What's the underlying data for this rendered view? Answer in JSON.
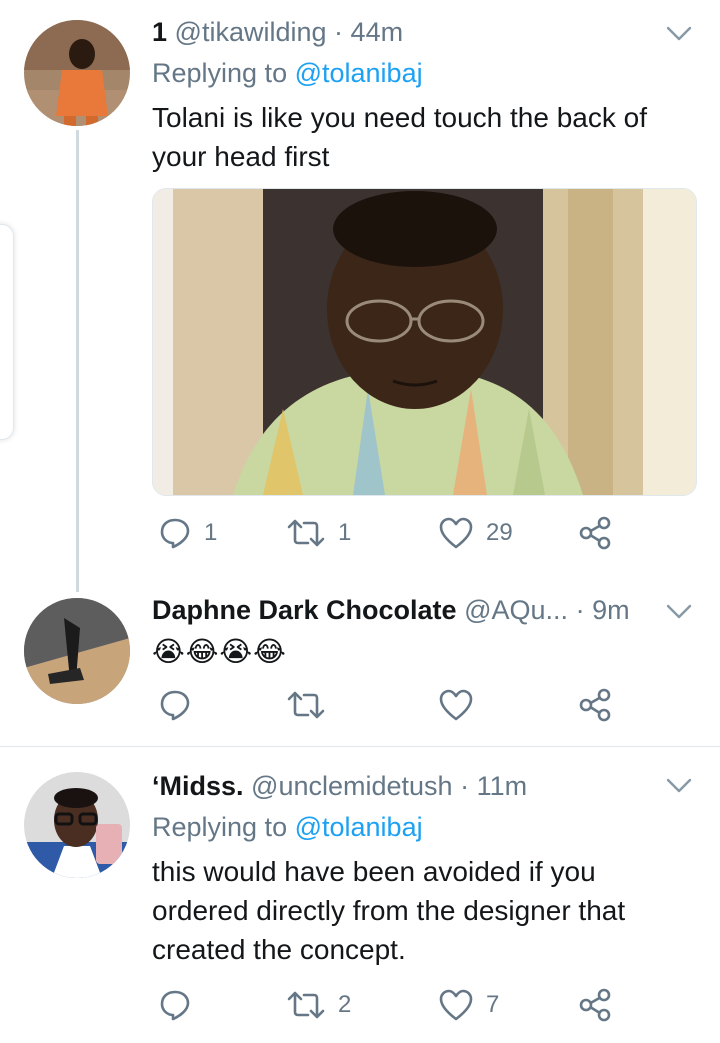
{
  "tweets": [
    {
      "name": "1",
      "handle": "@tikawilding",
      "sep": "·",
      "time": "44m",
      "replying_prefix": "Replying to ",
      "replying_to": "@tolanibaj",
      "text_line1": "Tolani is like you need touch the back of",
      "text_line2": "your head first",
      "replies": "1",
      "retweets": "1",
      "likes": "29"
    },
    {
      "name": "Daphne Dark Chocolate",
      "handle": "@AQu...",
      "sep": "·",
      "time": "9m",
      "emoji_text": "😭😂😭😂"
    },
    {
      "name": "‘Midss.",
      "handle": "@unclemidetush",
      "sep": "·",
      "time": "11m",
      "replying_prefix": "Replying to ",
      "replying_to": "@tolanibaj",
      "text_line1": "this would have been avoided if you",
      "text_line2": "ordered directly from the designer that",
      "text_line3": "created the concept.",
      "retweets": "2",
      "likes": "7"
    }
  ],
  "icons": {
    "reply": "reply-icon",
    "retweet": "retweet-icon",
    "like": "heart-icon",
    "share": "share-icon",
    "more": "chevron-down-icon"
  },
  "colors": {
    "text": "#14171a",
    "secondary": "#657786",
    "link": "#1da1f2",
    "divider": "#e1e8ed",
    "thread_line": "#cfd9de"
  }
}
